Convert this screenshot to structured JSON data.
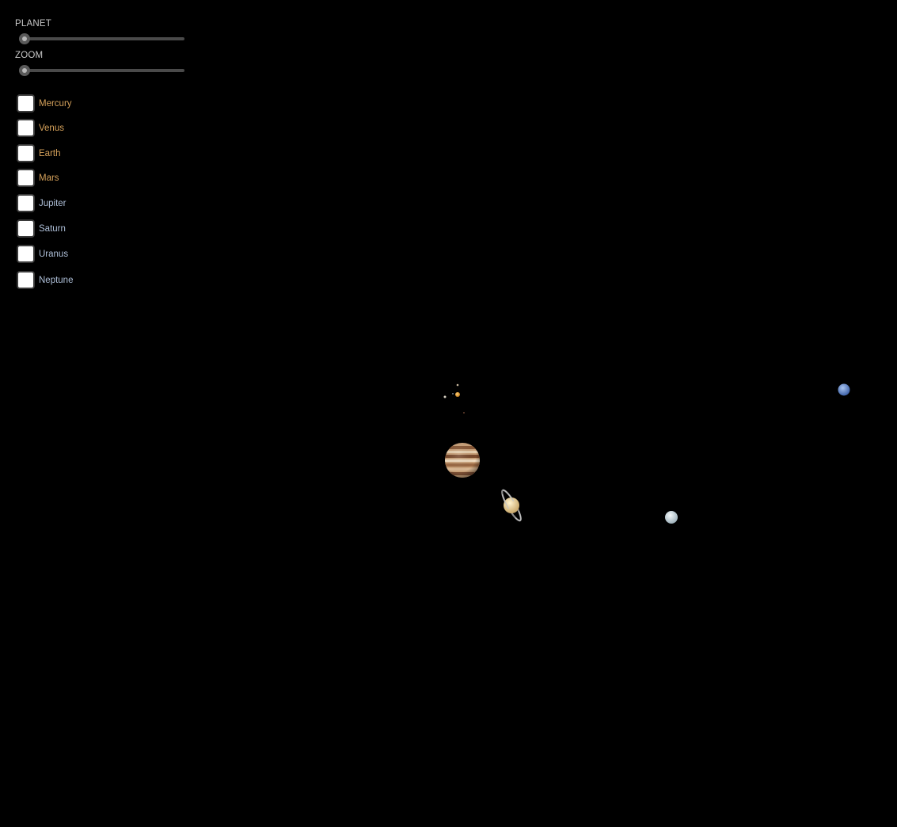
{
  "controls": {
    "planet_slider": {
      "label": "PLANET",
      "value": 0
    },
    "zoom_slider": {
      "label": "ZOOM",
      "value": 0
    }
  },
  "planets": [
    {
      "name": "Mercury",
      "checked": false,
      "group": "inner"
    },
    {
      "name": "Venus",
      "checked": false,
      "group": "inner"
    },
    {
      "name": "Earth",
      "checked": false,
      "group": "inner"
    },
    {
      "name": "Mars",
      "checked": false,
      "group": "inner"
    },
    {
      "name": "Jupiter",
      "checked": false,
      "group": "outer"
    },
    {
      "name": "Saturn",
      "checked": false,
      "group": "outer"
    },
    {
      "name": "Uranus",
      "checked": false,
      "group": "outer"
    },
    {
      "name": "Neptune",
      "checked": false,
      "group": "outer"
    }
  ],
  "colors": {
    "background": "#000000",
    "inner_label": "#d5a15a",
    "outer_label": "#aebfd8",
    "sun": "#e0a030",
    "jupiter": "#b88a5e",
    "saturn": "#e8d6a0",
    "uranus": "#d8e4ea",
    "neptune": "#6f95d8"
  }
}
